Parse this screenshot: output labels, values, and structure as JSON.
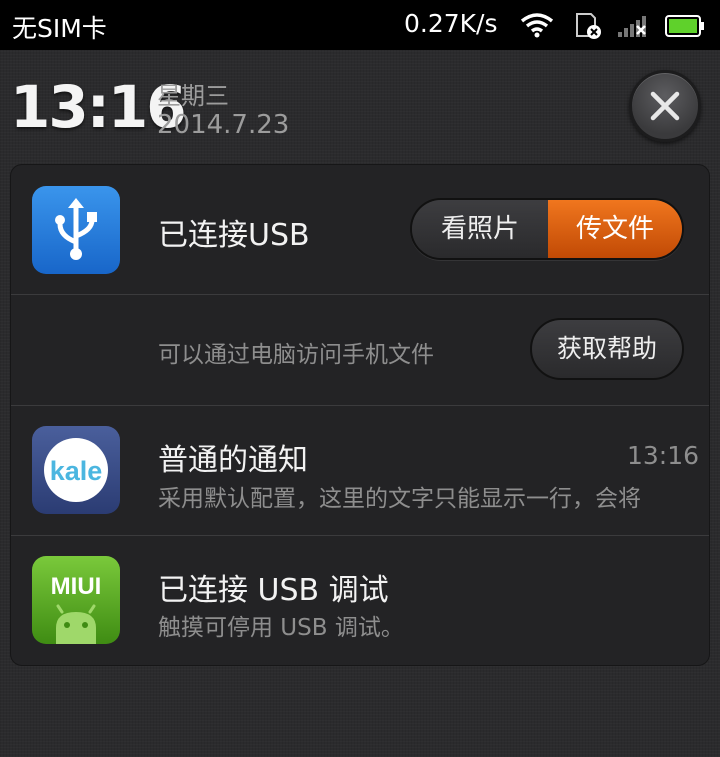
{
  "status_bar": {
    "carrier": "无SIM卡",
    "net_speed": "0.27K/s",
    "icons": [
      "wifi-icon",
      "sim-off-icon",
      "signal-no-service-icon",
      "battery-icon"
    ],
    "battery_color": "#5fd12b"
  },
  "header": {
    "time": "13:16",
    "weekday": "星期三",
    "date": "2014.7.23",
    "close_icon": "close-icon"
  },
  "notifications": {
    "usb": {
      "icon": "usb-icon",
      "title": "已连接USB",
      "option_photos": "看照片",
      "option_files": "传文件",
      "description": "可以通过电脑访问手机文件",
      "help_label": "获取帮助"
    },
    "normal": {
      "icon_text": "kale",
      "title": "普通的通知",
      "time": "13:16",
      "text": "采用默认配置，这里的文字只能显示一行，会将"
    },
    "debug": {
      "icon_text": "MIUI",
      "title": "已连接 USB 调试",
      "text": "触摸可停用 USB 调试。"
    }
  },
  "colors": {
    "accent_orange": "#e0620f",
    "usb_icon_blue": "#2a7fdc",
    "miui_green": "#5aaa25"
  }
}
